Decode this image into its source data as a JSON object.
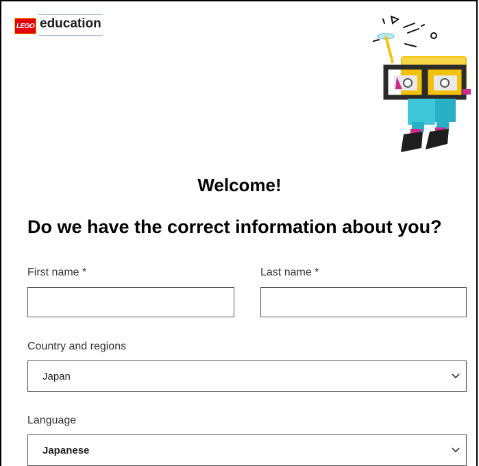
{
  "brand": {
    "badge_text": "LEGO",
    "name": "education",
    "badge_color": "#e3000b"
  },
  "heading": {
    "welcome": "Welcome!",
    "question": "Do we have the correct information about you?"
  },
  "form": {
    "first_name_label": "First name *",
    "first_name_value": "",
    "last_name_label": "Last name *",
    "last_name_value": "",
    "country_label": "Country and regions",
    "country_value": "Japan",
    "language_label": "Language",
    "language_value": "Japanese"
  },
  "icons": {
    "dropdown": "chevron-down-icon",
    "illustration": "robot-illustration"
  }
}
